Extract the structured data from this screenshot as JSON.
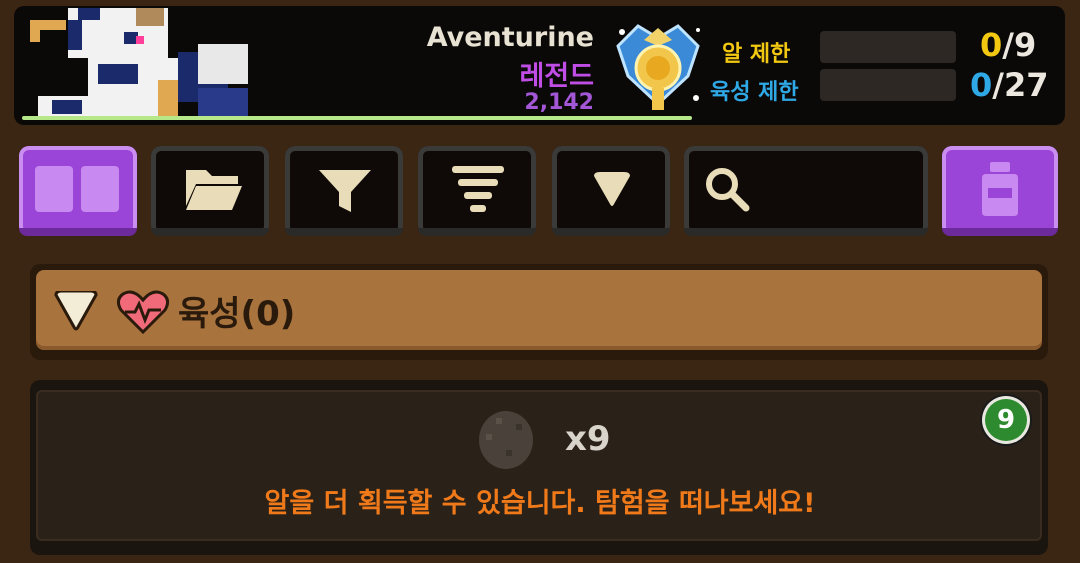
{
  "pet": {
    "name": "Aventurine",
    "rank": "레전드",
    "rating": "2,142"
  },
  "limits": {
    "egg_label": "알 제한",
    "egg_current": "0",
    "egg_max": "/9",
    "raise_label": "육성 제한",
    "raise_current": "0",
    "raise_max": "/27"
  },
  "colors": {
    "egg_current": "#f2c811",
    "raise_current": "#2fa8e6",
    "rank": "#c04ee6",
    "accent_purple": "#9b45d8",
    "message": "#f07a1a",
    "badge_green": "#2e8a2e"
  },
  "toolbar": {
    "icons": [
      "grid-view-icon",
      "folder-icon",
      "filter-icon",
      "sort-icon",
      "dropdown-icon",
      "search-icon",
      "bottle-icon"
    ]
  },
  "search": {
    "placeholder": ""
  },
  "section": {
    "title": "육성(0)"
  },
  "egg_panel": {
    "count": "x9",
    "message": "알을 더 획득할 수 있습니다. 탐험을 떠나보세요!",
    "badge": "9"
  }
}
